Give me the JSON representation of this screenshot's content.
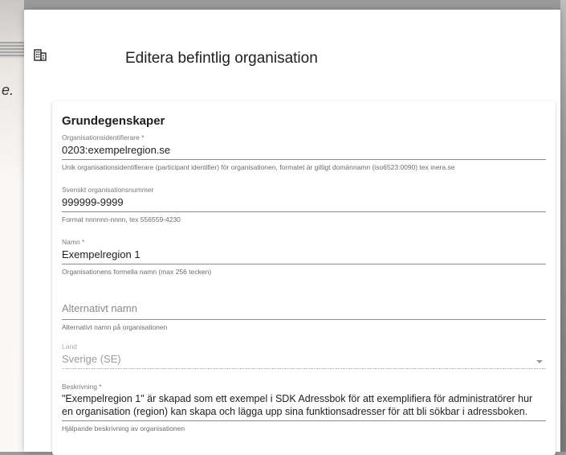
{
  "background": {
    "fragment_text": "e."
  },
  "dialog": {
    "icon": "organization-building-icon",
    "title": "Editera befintlig organisation"
  },
  "card": {
    "section_title": "Grundegenskaper",
    "fields": {
      "org_id": {
        "label": "Organisationsidentifierare *",
        "value": "0203:exempelregion.se",
        "hint": "Unik organisationsidentifierare (participant identifier) för organisationen, formatet är giltigt domännamn (iso6523:0090) tex inera.se"
      },
      "org_number": {
        "label": "Svenskt organisationsnummer",
        "value": "999999-9999",
        "hint": "Format nnnnnn-nnnn, tex 556559-4230"
      },
      "name": {
        "label": "Namn *",
        "value": "Exempelregion 1",
        "hint": "Organisationens formella namn (max 256 tecken)"
      },
      "alt_name": {
        "placeholder": "Alternativt namn",
        "hint": "Alternativt namn på organisationen"
      },
      "country": {
        "label": "Land",
        "value": "Sverige (SE)"
      },
      "description": {
        "label": "Beskrivning *",
        "value": "\"Exempelregion 1\" är skapad som ett exempel i SDK Adressbok för att exemplifiera för administratörer hur en organisation (region) kan skapa och lägga upp sina funktionsadresser för att bli sökbar i adressboken.",
        "hint": "Hjälpande beskrivning av organisationen"
      }
    }
  }
}
